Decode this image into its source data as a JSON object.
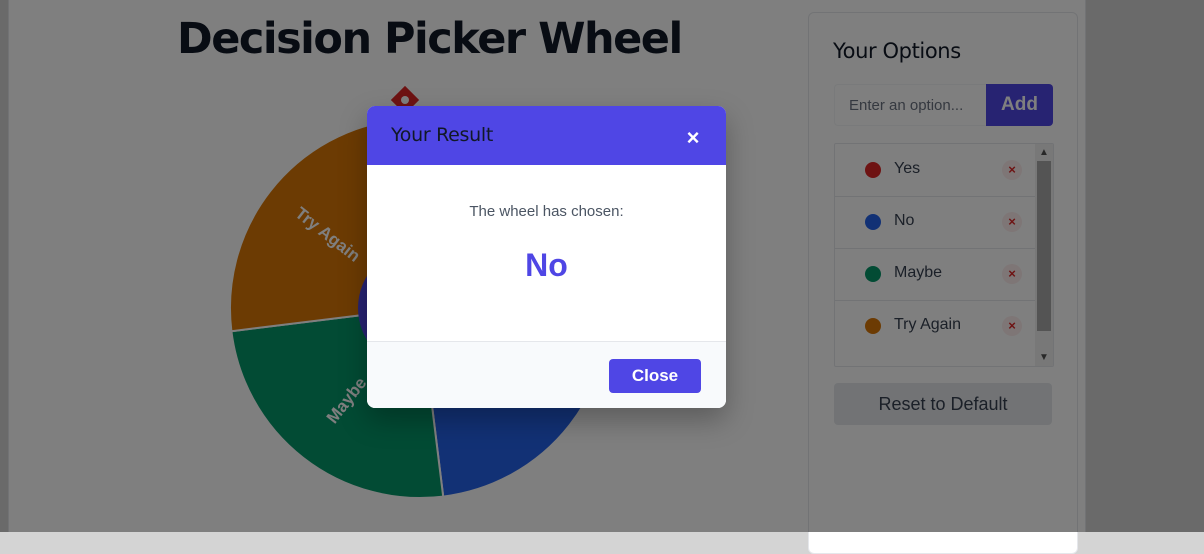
{
  "app": {
    "title": "Decision Picker Wheel"
  },
  "wheel": {
    "segments": [
      {
        "label": "Yes",
        "color": "#dc2626"
      },
      {
        "label": "No",
        "color": "#2563eb"
      },
      {
        "label": "Maybe",
        "color": "#059669"
      },
      {
        "label": "Try Again",
        "color": "#d97706"
      }
    ],
    "center_color": "#4f46e5",
    "pointer_color": "#dc2626"
  },
  "options_panel": {
    "title": "Your Options",
    "input_placeholder": "Enter an option...",
    "input_value": "",
    "add_label": "Add",
    "options": [
      {
        "label": "Yes",
        "color": "#dc2626",
        "remove_glyph": "×"
      },
      {
        "label": "No",
        "color": "#2563eb",
        "remove_glyph": "×"
      },
      {
        "label": "Maybe",
        "color": "#059669",
        "remove_glyph": "×"
      },
      {
        "label": "Try Again",
        "color": "#d97706",
        "remove_glyph": "×"
      }
    ],
    "reset_label": "Reset to Default"
  },
  "modal": {
    "title": "Your Result",
    "close_glyph": "×",
    "message": "The wheel has chosen:",
    "result": "No",
    "close_label": "Close"
  },
  "colors": {
    "accent": "#4f46e5",
    "overlay": "rgba(0,0,0,0.5)"
  }
}
